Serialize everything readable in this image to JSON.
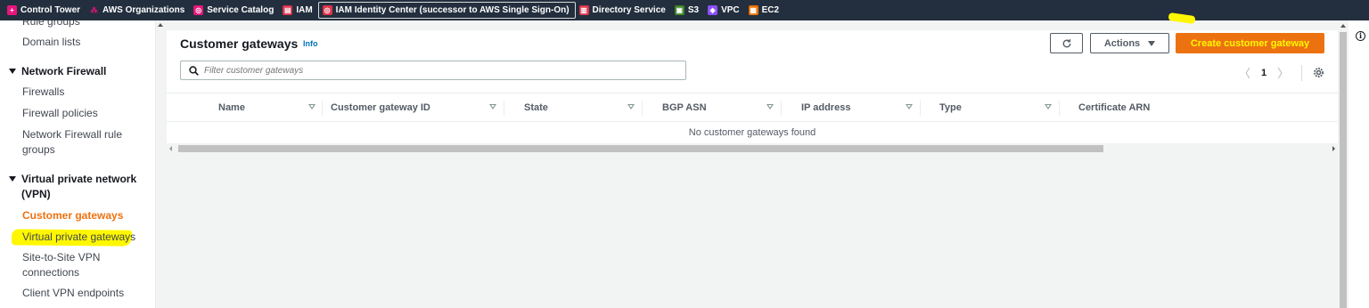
{
  "favorites_bar": [
    {
      "label": "Control Tower",
      "icon": "control-tower-icon",
      "color": "#e7157b",
      "glyph": "+"
    },
    {
      "label": "AWS Organizations",
      "icon": "organizations-icon",
      "color": "#232f3e",
      "glyph": "⁂"
    },
    {
      "label": "Service Catalog",
      "icon": "service-catalog-icon",
      "color": "#e7157b",
      "glyph": "◎"
    },
    {
      "label": "IAM",
      "icon": "iam-icon",
      "color": "#dd344c",
      "glyph": "▤"
    },
    {
      "label": "IAM Identity Center (successor to AWS Single Sign-On)",
      "icon": "identity-center-icon",
      "color": "#dd344c",
      "glyph": "◎"
    },
    {
      "label": "Directory Service",
      "icon": "directory-service-icon",
      "color": "#dd344c",
      "glyph": "▥"
    },
    {
      "label": "S3",
      "icon": "s3-icon",
      "color": "#3f8624",
      "glyph": "▣"
    },
    {
      "label": "VPC",
      "icon": "vpc-icon",
      "color": "#8c4fff",
      "glyph": "◈"
    },
    {
      "label": "EC2",
      "icon": "ec2-icon",
      "color": "#ed7100",
      "glyph": "▦"
    }
  ],
  "sidebar": {
    "items": [
      {
        "label": "Rule groups"
      },
      {
        "label": "Domain lists"
      },
      {
        "section": "Network Firewall"
      },
      {
        "label": "Firewalls"
      },
      {
        "label": "Firewall policies"
      },
      {
        "label_line1": "Network Firewall rule",
        "label_line2": "groups"
      },
      {
        "section_line1": "Virtual private network",
        "section_line2": "(VPN)"
      },
      {
        "label": "Customer gateways",
        "current": true
      },
      {
        "label": "Virtual private gateways"
      },
      {
        "label_line1": "Site-to-Site VPN",
        "label_line2": "connections"
      },
      {
        "label": "Client VPN endpoints"
      }
    ]
  },
  "header": {
    "title": "Customer gateways",
    "info_link": "Info",
    "actions_label": "Actions",
    "create_label": "Create customer gateway"
  },
  "search": {
    "placeholder": "Filter customer gateways"
  },
  "pagination": {
    "current_page": "1"
  },
  "table": {
    "columns": [
      "Name",
      "Customer gateway ID",
      "State",
      "BGP ASN",
      "IP address",
      "Type",
      "Certificate ARN"
    ],
    "empty_message": "No customer gateways found"
  },
  "colors": {
    "accent": "#ec7211",
    "highlight": "#fff700",
    "link": "#0073bb",
    "topbar": "#232f3e"
  }
}
